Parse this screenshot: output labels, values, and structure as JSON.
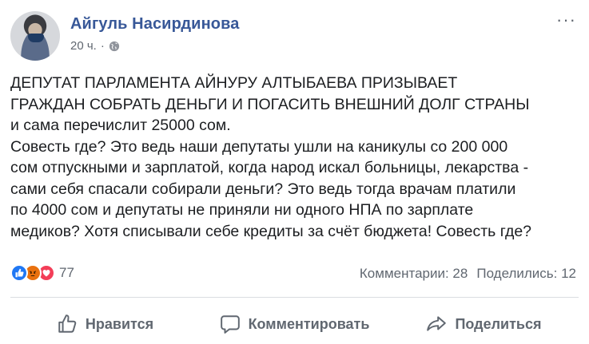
{
  "post": {
    "author": "Айгуль Насирдинова",
    "time": "20 ч.",
    "separator": "·",
    "more": "···",
    "body": "ДЕПУТАТ ПАРЛАМЕНТА АЙНУРУ АЛТЫБАЕВА ПРИЗЫВАЕТ\nГРАЖДАН СОБРАТЬ ДЕНЬГИ И ПОГАСИТЬ ВНЕШНИЙ ДОЛГ СТРАНЫ\nи сама перечислит 25000 сом.\nСовесть где? Это ведь наши депутаты ушли на каникулы со 200 000\nсом отпускными и зарплатой, когда народ искал больницы, лекарства -\nсами себя спасали собирали деньги? Это ведь тогда врачам платили\nпо 4000 сом и депутаты не приняли ни одного НПА по зарплате\nмедиков? Хотя списывали себе кредиты за счёт бюджета! Совесть где?"
  },
  "reactions": {
    "icons": [
      "like-reaction",
      "angry-reaction",
      "love-reaction"
    ],
    "count": "77",
    "colors": {
      "like": "#2078f4",
      "angry": "#e9710f",
      "love": "#f33e58"
    }
  },
  "stats": {
    "comments": "Комментарии: 28",
    "shares": "Поделились: 12"
  },
  "actions": {
    "like": "Нравится",
    "comment": "Комментировать",
    "share": "Поделиться"
  },
  "colors": {
    "author_link": "#385898",
    "secondary_text": "#606770"
  }
}
